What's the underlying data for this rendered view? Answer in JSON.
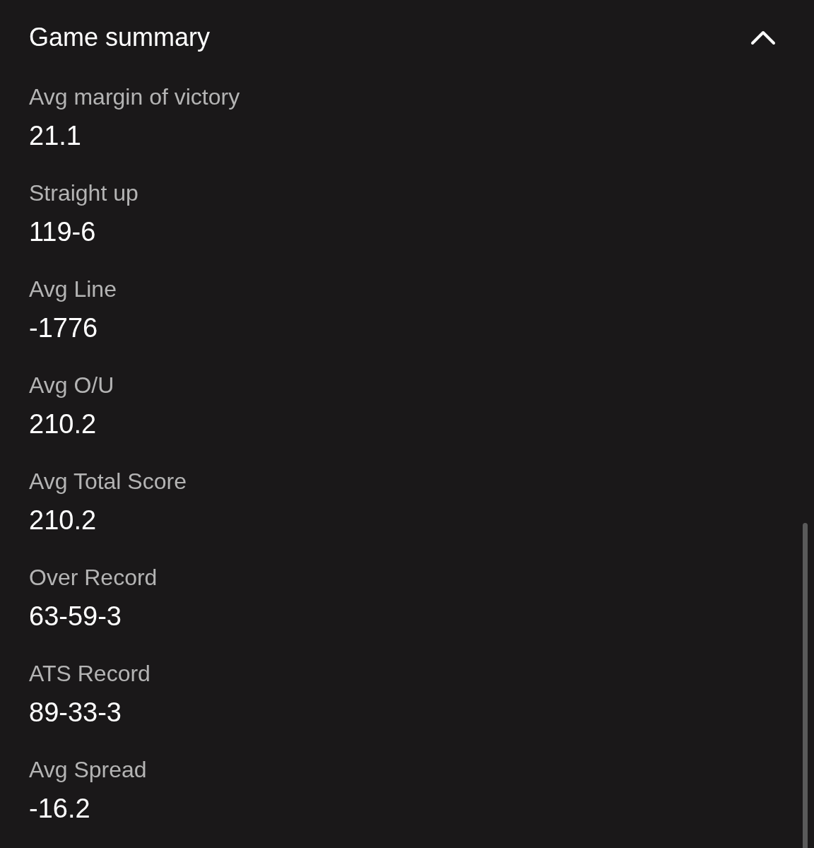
{
  "section": {
    "title": "Game summary",
    "expanded": true
  },
  "stats": [
    {
      "label": "Avg margin of victory",
      "value": "21.1"
    },
    {
      "label": "Straight up",
      "value": "119-6"
    },
    {
      "label": "Avg Line",
      "value": "-1776"
    },
    {
      "label": "Avg O/U",
      "value": "210.2"
    },
    {
      "label": "Avg Total Score",
      "value": "210.2"
    },
    {
      "label": "Over Record",
      "value": "63-59-3"
    },
    {
      "label": "ATS Record",
      "value": "89-33-3"
    },
    {
      "label": "Avg Spread",
      "value": "-16.2"
    }
  ]
}
